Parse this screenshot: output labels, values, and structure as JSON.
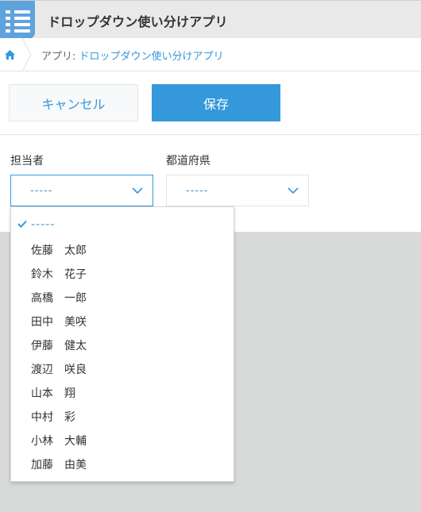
{
  "header": {
    "title": "ドロップダウン使い分けアプリ",
    "icon": "app-list-icon",
    "icon_color": "#5fa3dd"
  },
  "breadcrumb": {
    "prefix": "アプリ: ",
    "app_link": "ドロップダウン使い分けアプリ",
    "home_icon": "home-icon"
  },
  "toolbar": {
    "cancel_label": "キャンセル",
    "save_label": "保存"
  },
  "form": {
    "assignee": {
      "label": "担当者",
      "value": "-----"
    },
    "prefecture": {
      "label": "都道府県",
      "value": "-----"
    }
  },
  "dropdown": {
    "options": [
      {
        "label": "-----",
        "selected": true
      },
      {
        "label": "佐藤　太郎"
      },
      {
        "label": "鈴木　花子"
      },
      {
        "label": "高橋　一郎"
      },
      {
        "label": "田中　美咲"
      },
      {
        "label": "伊藤　健太"
      },
      {
        "label": "渡辺　咲良"
      },
      {
        "label": "山本　翔"
      },
      {
        "label": "中村　彩"
      },
      {
        "label": "小林　大輔"
      },
      {
        "label": "加藤　由美"
      }
    ]
  },
  "colors": {
    "accent": "#3498db",
    "background": "#d8d9d9",
    "header_bg": "#e9e9e9"
  }
}
